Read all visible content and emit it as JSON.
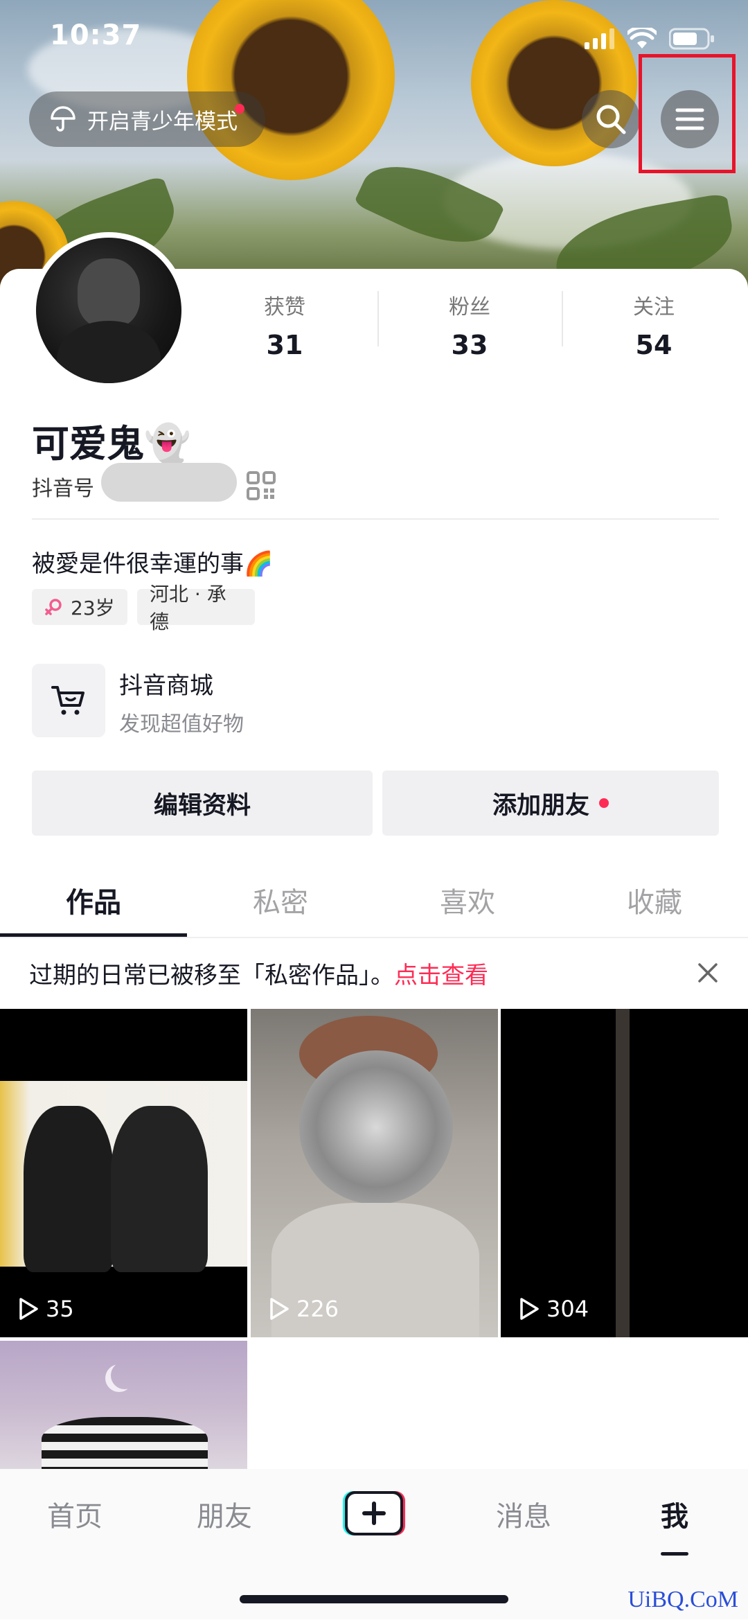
{
  "status_bar": {
    "time": "10:37"
  },
  "header": {
    "youth_mode_label": "开启青少年模式",
    "search_icon": "search-icon",
    "menu_icon": "menu-icon"
  },
  "stats": [
    {
      "label": "获赞",
      "value": "31"
    },
    {
      "label": "粉丝",
      "value": "33"
    },
    {
      "label": "关注",
      "value": "54"
    }
  ],
  "profile": {
    "name": "可爱鬼👻",
    "douyin_id_label": "抖音号",
    "bio": "被愛是件很幸運的事🌈",
    "tags": [
      {
        "label": "23岁"
      },
      {
        "label": "河北 · 承德"
      }
    ]
  },
  "shop": {
    "title": "抖音商城",
    "subtitle": "发现超值好物"
  },
  "actions": {
    "edit_profile": "编辑资料",
    "add_friends": "添加朋友"
  },
  "tabs": [
    {
      "label": "作品"
    },
    {
      "label": "私密"
    },
    {
      "label": "喜欢"
    },
    {
      "label": "收藏"
    }
  ],
  "notice": {
    "text": "过期的日常已被移至「私密作品」。",
    "link": "点击查看"
  },
  "videos": [
    {
      "plays": "35"
    },
    {
      "plays": "226"
    },
    {
      "plays": "304"
    }
  ],
  "bottom_nav": [
    {
      "label": "首页"
    },
    {
      "label": "朋友"
    },
    {
      "label": "消息"
    },
    {
      "label": "我"
    }
  ],
  "watermark": "UiBQ.CoM",
  "colors": {
    "accent": "#fe2c55",
    "highlight_frame": "#e8132a",
    "text_primary": "#161823"
  }
}
